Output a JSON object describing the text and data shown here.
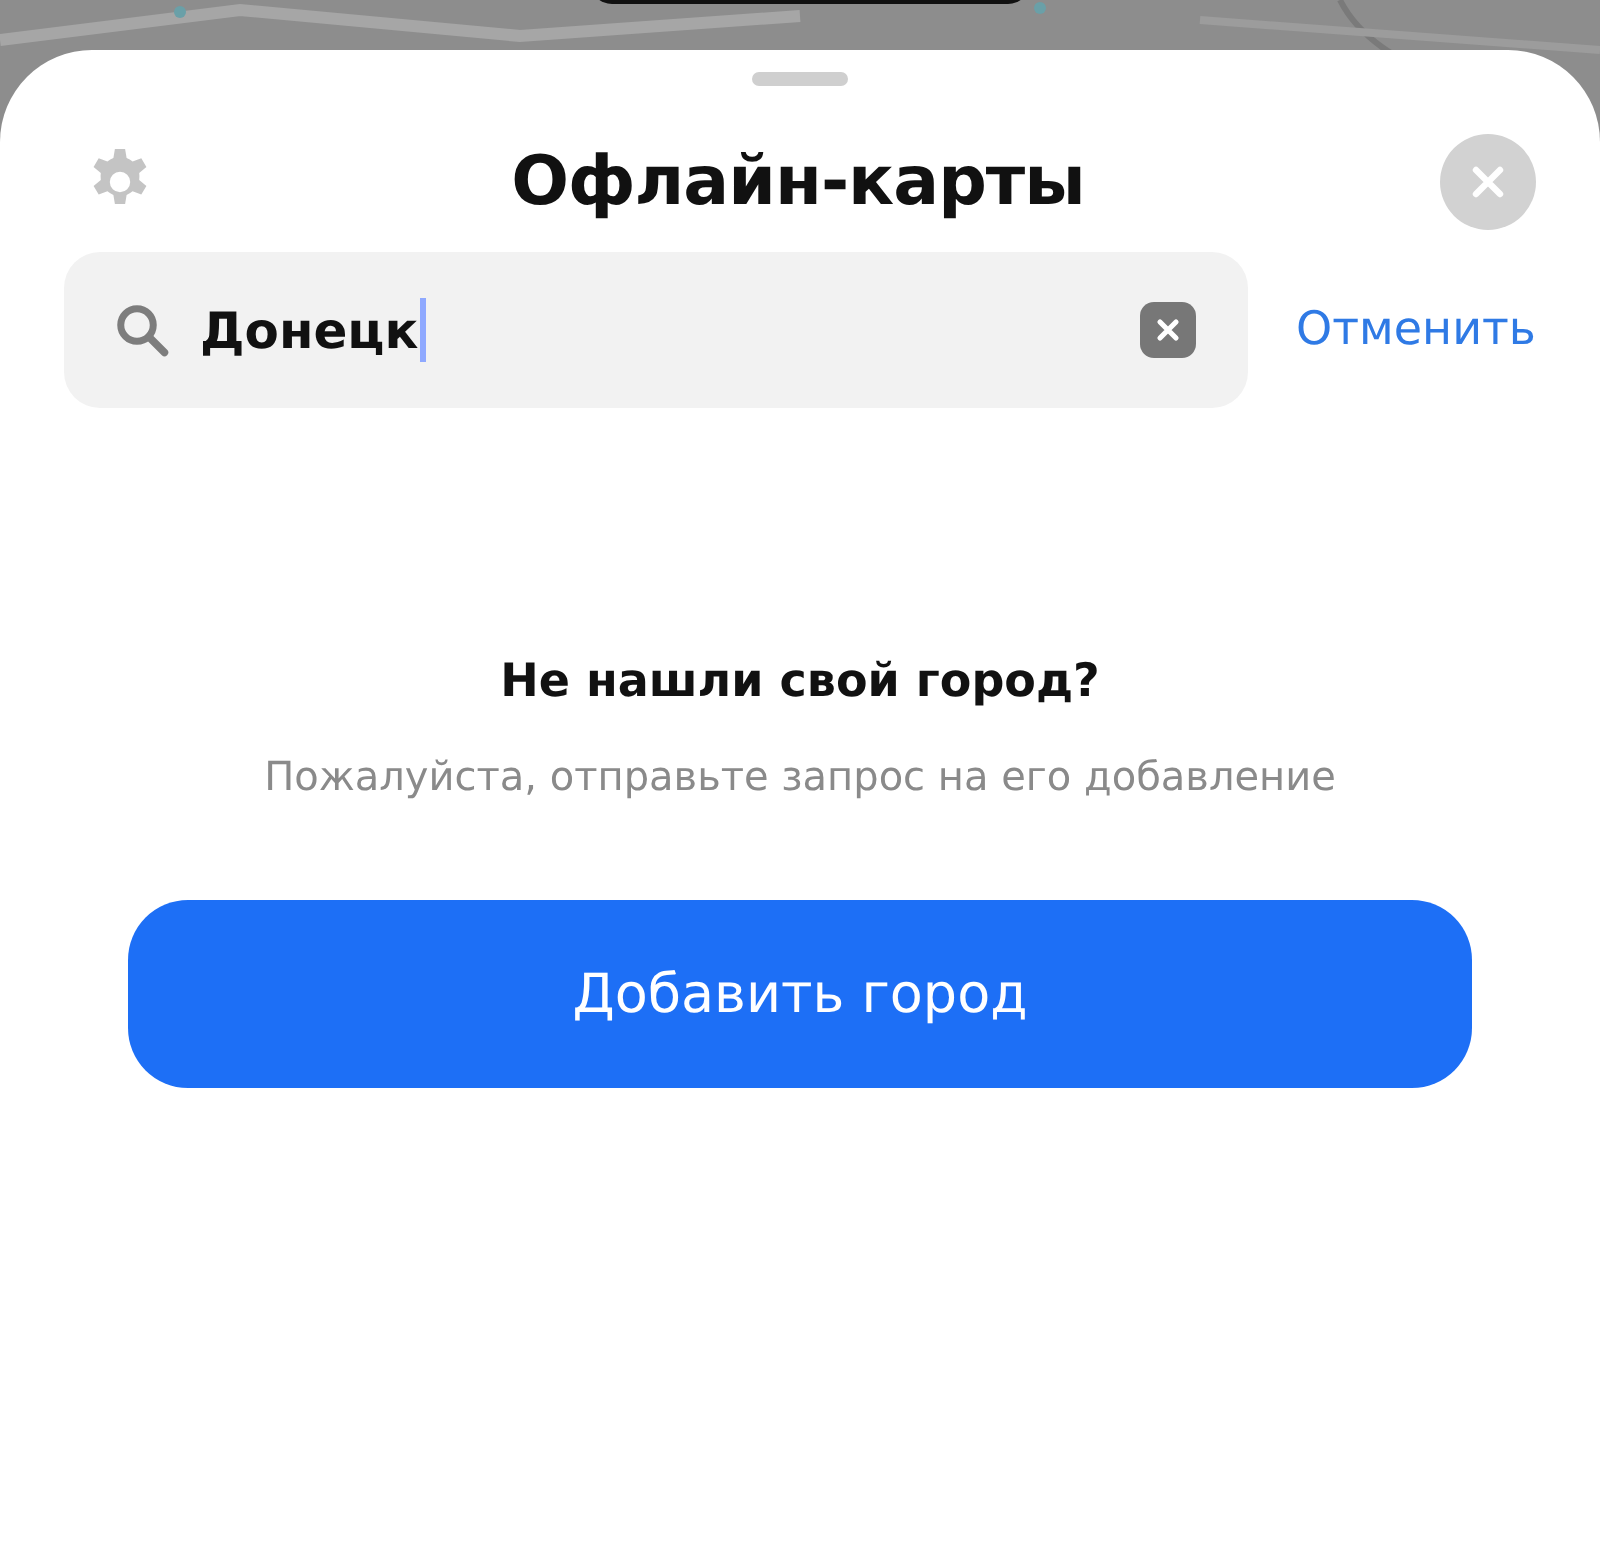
{
  "sheet": {
    "title": "Офлайн-карты"
  },
  "search": {
    "value": "Донецк",
    "focused": true,
    "cancel": "Отменить"
  },
  "empty_state": {
    "heading": "Не нашли свой город?",
    "text": "Пожалуйста, отправьте запрос на его добавление",
    "button": "Добавить город"
  }
}
